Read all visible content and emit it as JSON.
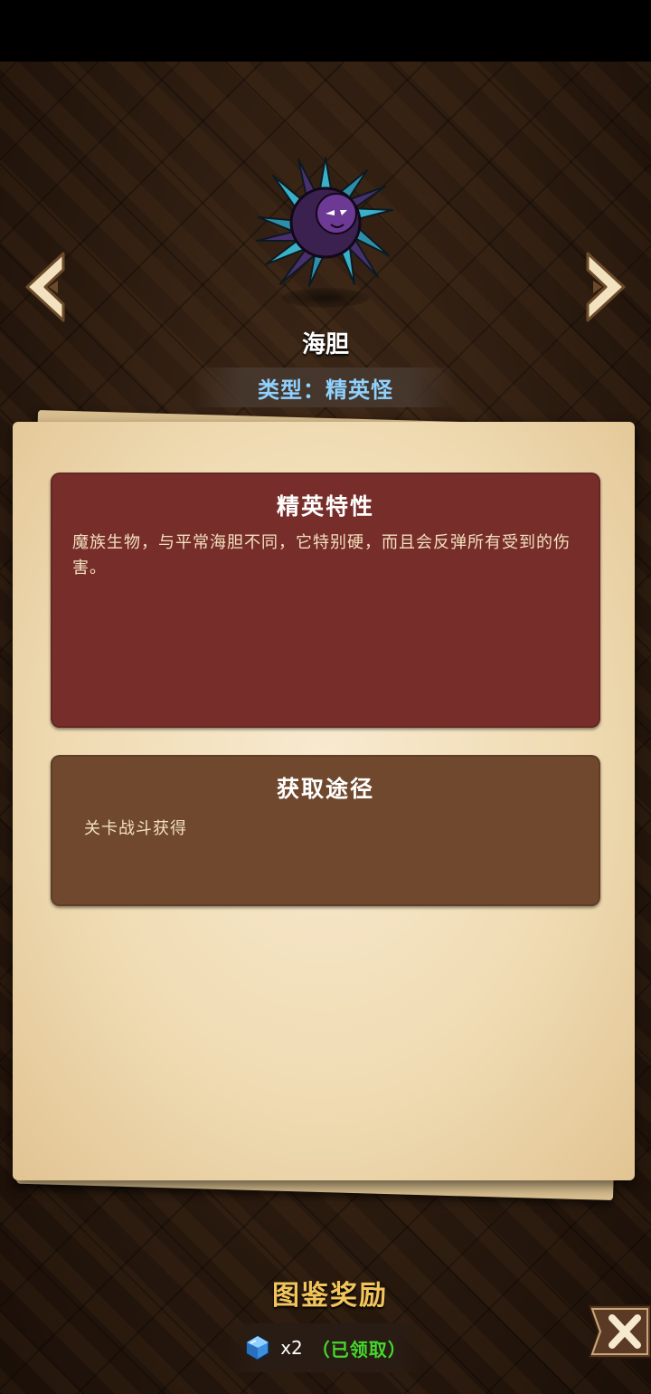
{
  "monster": {
    "name": "海胆",
    "type_label": "类型：精英怪",
    "image": "purple-sea-urchin-icon"
  },
  "navigation": {
    "prev": "chevron-left-icon",
    "next": "chevron-right-icon"
  },
  "elite_traits": {
    "title": "精英特性",
    "description": "魔族生物，与平常海胆不同，它特别硬，而且会反弹所有受到的伤害。"
  },
  "acquisition": {
    "title": "获取途径",
    "description": "关卡战斗获得"
  },
  "reward": {
    "title": "图鉴奖励",
    "icon": "blue-gem-icon",
    "count": "x2",
    "status": "（已领取）"
  },
  "close": {
    "icon": "close-x-icon"
  },
  "colors": {
    "type_text": "#8fd2ff",
    "elite_card": "#772e2b",
    "source_card": "#70482d",
    "reward_title": "#f2c45c",
    "claimed_status": "#45d82d",
    "paper": "#f0dcb4"
  }
}
